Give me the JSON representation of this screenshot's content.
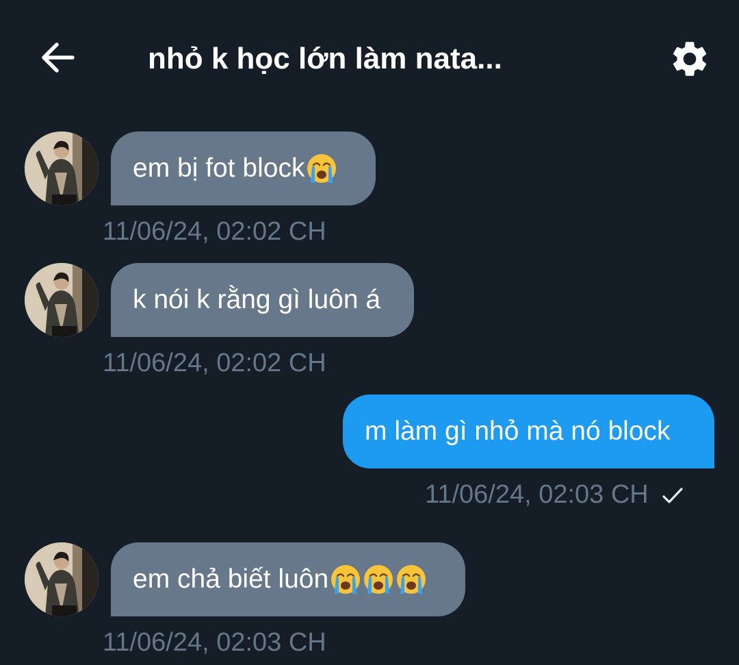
{
  "header": {
    "title": "nhỏ k học lớn làm nata...",
    "back_icon": "arrow-left-icon",
    "settings_icon": "gear-icon"
  },
  "messages": [
    {
      "direction": "incoming",
      "text": "em bị fot block",
      "emoji_count": 1,
      "timestamp": "11/06/24, 02:02 CH"
    },
    {
      "direction": "incoming",
      "text": "k nói k rằng gì luôn á",
      "emoji_count": 0,
      "timestamp": "11/06/24, 02:02 CH"
    },
    {
      "direction": "outgoing",
      "text": "m làm gì nhỏ mà nó block",
      "emoji_count": 0,
      "timestamp": "11/06/24, 02:03 CH",
      "status_icon": "checkmark-icon"
    },
    {
      "direction": "incoming",
      "text": "em chả biết luôn",
      "emoji_count": 3,
      "timestamp": "11/06/24, 02:03 CH"
    }
  ],
  "colors": {
    "background": "#151d27",
    "incoming_bubble": "#66788a",
    "outgoing_bubble": "#1d9bf0",
    "timestamp": "#66778a"
  }
}
